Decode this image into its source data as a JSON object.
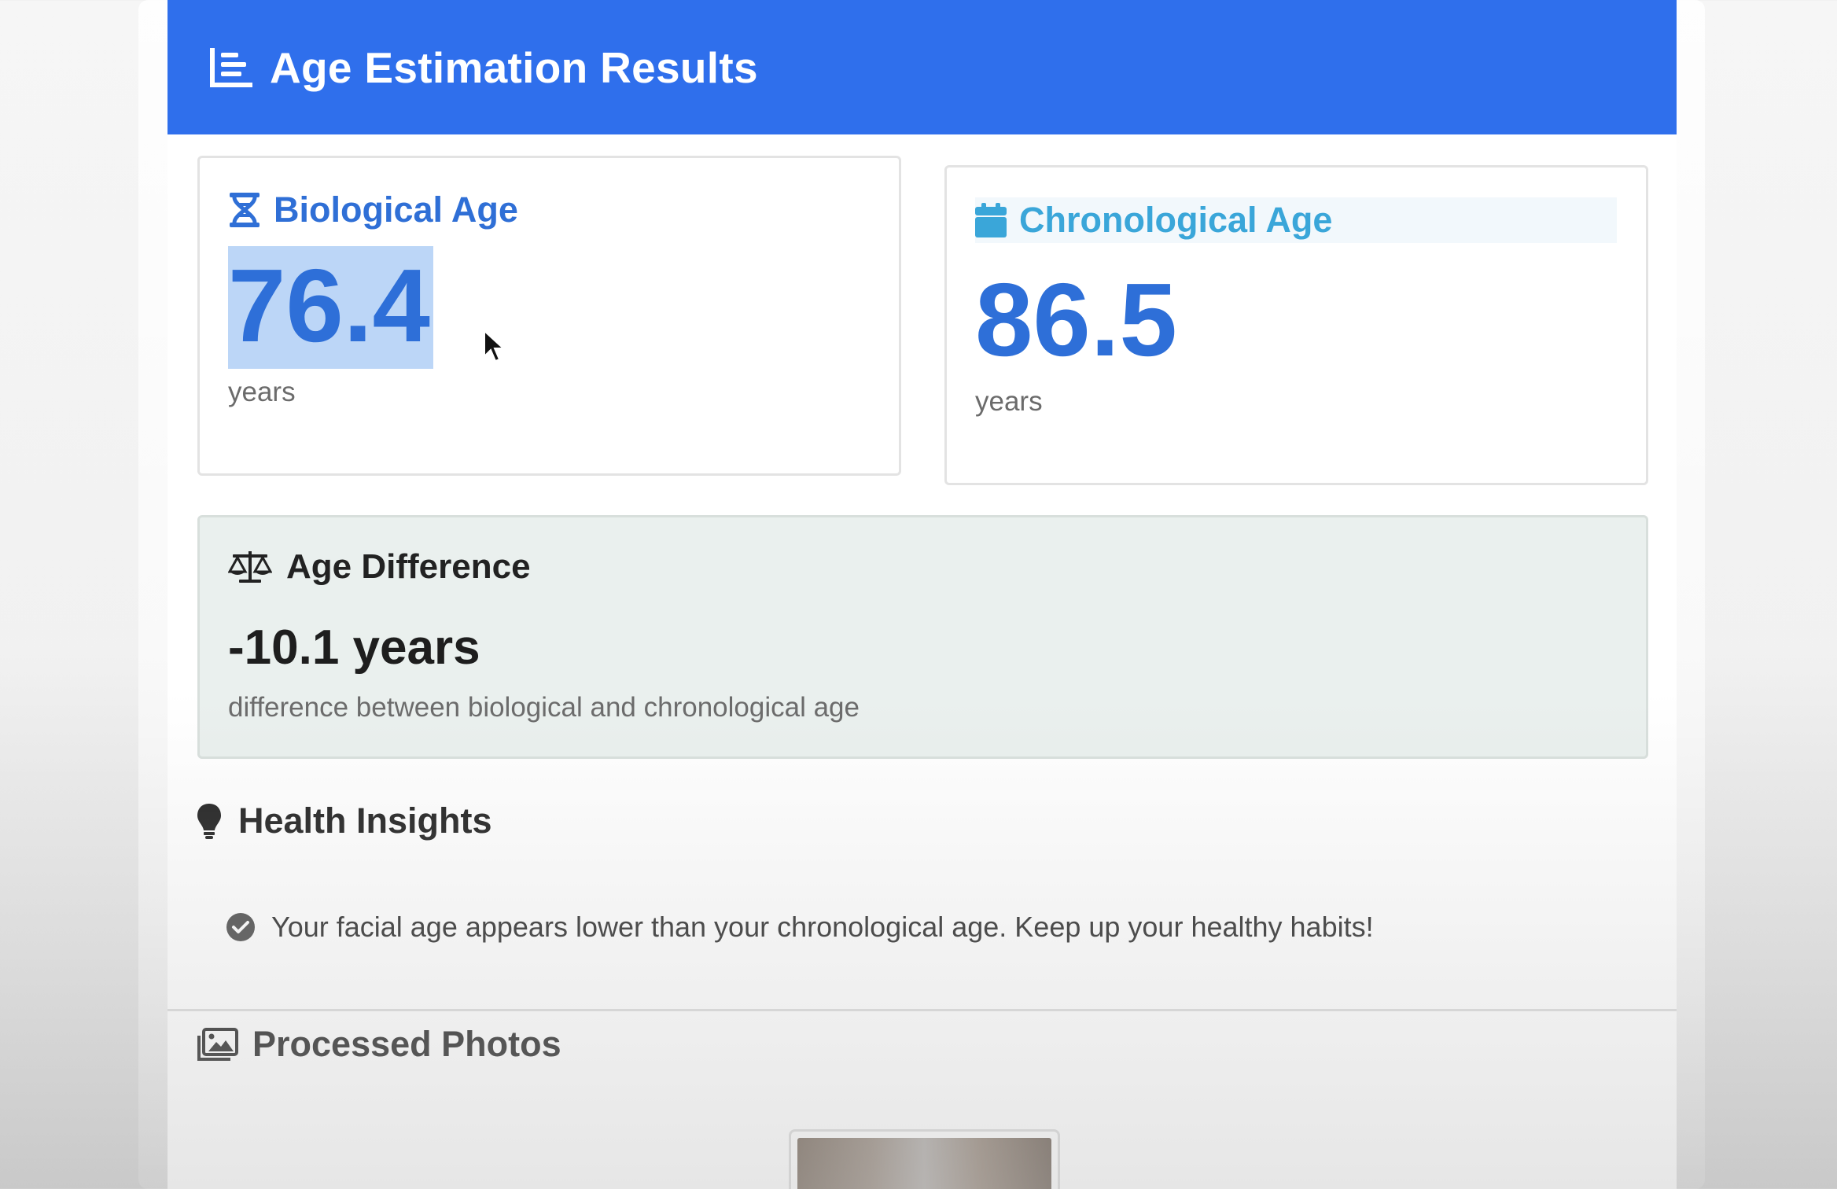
{
  "header": {
    "title": "Age Estimation Results",
    "icon": "chart-list-icon"
  },
  "biological": {
    "title": "Biological Age",
    "icon": "dna-icon",
    "value": "76.4",
    "unit": "years",
    "color": "#2f6fd6"
  },
  "chronological": {
    "title": "Chronological Age",
    "icon": "calendar-icon",
    "value": "86.5",
    "unit": "years",
    "color": "#3aa6d9"
  },
  "difference": {
    "title": "Age Difference",
    "icon": "balance-scale-icon",
    "value": "-10.1 years",
    "description": "difference between biological and chronological age"
  },
  "insights": {
    "title": "Health Insights",
    "icon": "lightbulb-icon",
    "items": [
      {
        "text": "Your facial age appears lower than your chronological age. Keep up your healthy habits!",
        "icon": "check-circle-icon"
      }
    ]
  },
  "photos": {
    "title": "Processed Photos",
    "icon": "images-icon"
  },
  "colors": {
    "header_bg": "#2f6fec",
    "accent": "#2e6fd8",
    "selection": "#bcd6f7",
    "difference_bg": "#eaf0ee"
  }
}
